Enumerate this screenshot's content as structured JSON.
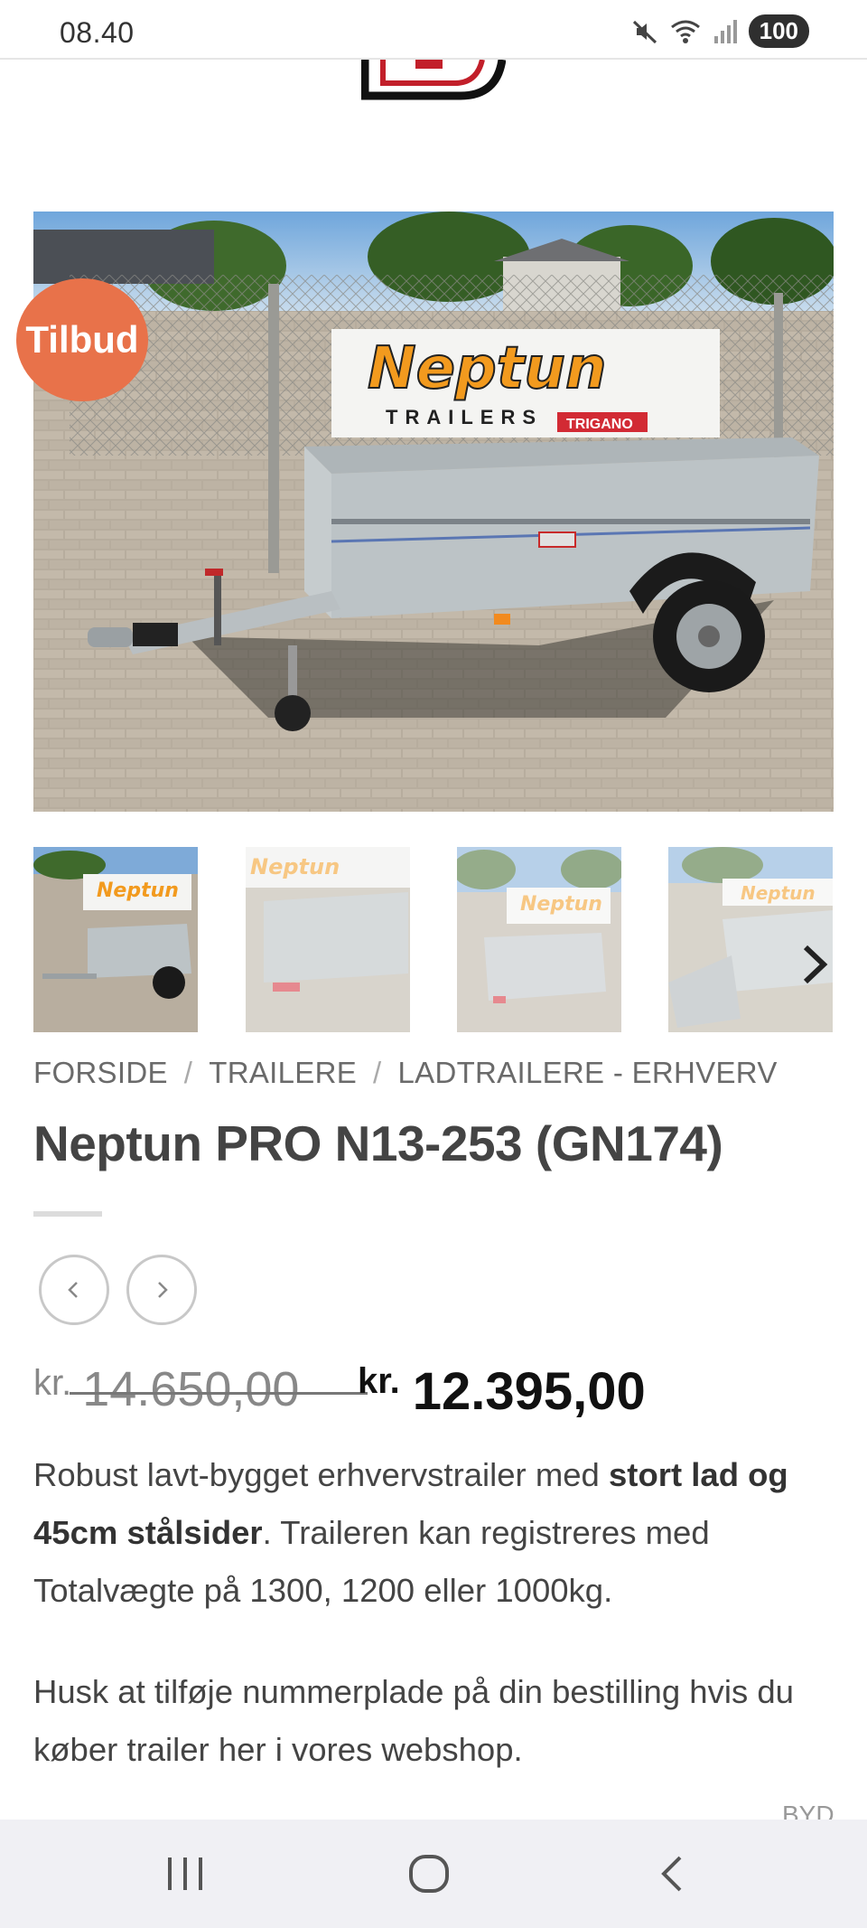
{
  "status_bar": {
    "time": "08.40",
    "battery": "100",
    "icons": [
      "mute-icon",
      "wifi-icon",
      "signal-icon",
      "battery-icon"
    ]
  },
  "product": {
    "badge": "Tilbud",
    "breadcrumb": [
      "FORSIDE",
      "TRAILERE",
      "LADTRAILERE - ERHVERV"
    ],
    "breadcrumb_separator": "/",
    "title": "Neptun PRO N13-253 (GN174)",
    "old_price": {
      "currency": "kr.",
      "amount": "14.650,00"
    },
    "new_price": {
      "currency": "kr.",
      "amount": "12.395,00"
    },
    "description": {
      "part1": "Robust lavt-bygget erhvervstrailer med ",
      "bold": "stort lad og 45cm stålsider",
      "part2": ". Traileren kan registreres med Totalvægte på 1300, 1200 eller 1000kg."
    },
    "note": "Husk at tilføje nummerplade på din bestilling hvis du køber trailer her i vores webshop.",
    "cutoff_text": "BYD"
  },
  "hero_sign": {
    "brand": "Neptun",
    "subtitle": "TRAILERS",
    "maker": "TRIGANO"
  },
  "colors": {
    "badge": "#e8724a",
    "text": "#444444",
    "breadcrumb": "#6a6a6a"
  }
}
